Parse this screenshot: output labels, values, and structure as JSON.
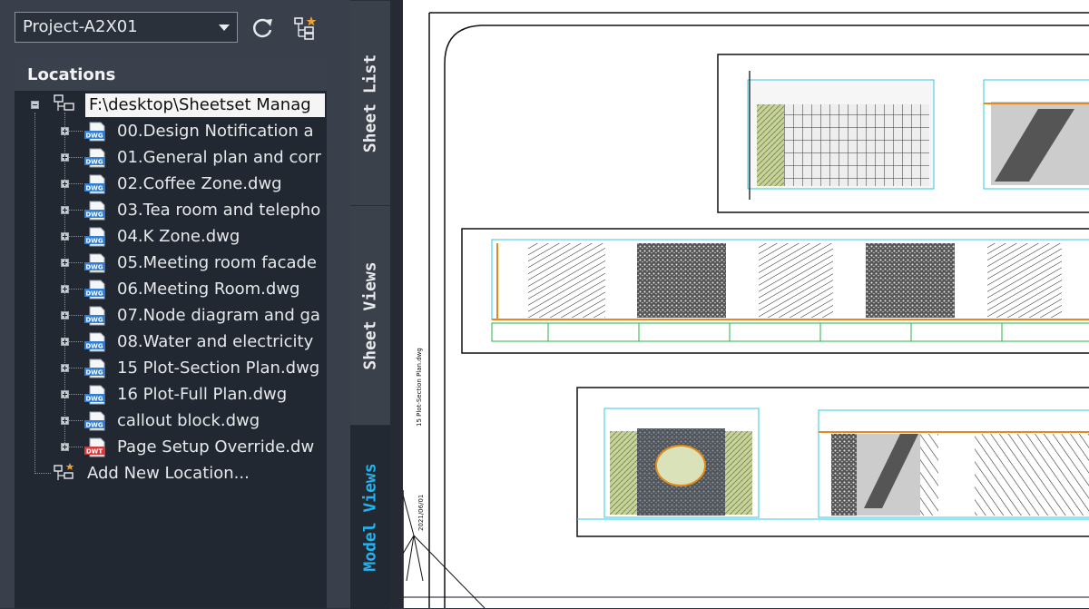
{
  "project_selector": {
    "value": "Project-A2X01"
  },
  "icons": {
    "refresh": "refresh-icon",
    "tree": "location-tree-icon"
  },
  "locations": {
    "header": "Locations",
    "root": {
      "label": "F:\\desktop\\Sheetset Manag"
    },
    "files": [
      {
        "label": "00.Design Notification a",
        "type": "DWG"
      },
      {
        "label": "01.General plan and corr",
        "type": "DWG"
      },
      {
        "label": "02.Coffee Zone.dwg",
        "type": "DWG"
      },
      {
        "label": "03.Tea room and telepho",
        "type": "DWG"
      },
      {
        "label": "04.K Zone.dwg",
        "type": "DWG"
      },
      {
        "label": "05.Meeting room facade",
        "type": "DWG"
      },
      {
        "label": "06.Meeting Room.dwg",
        "type": "DWG"
      },
      {
        "label": "07.Node diagram and ga",
        "type": "DWG"
      },
      {
        "label": "08.Water and electricity",
        "type": "DWG"
      },
      {
        "label": "15 Plot-Section Plan.dwg",
        "type": "DWG"
      },
      {
        "label": "16 Plot-Full Plan.dwg",
        "type": "DWG"
      },
      {
        "label": "callout block.dwg",
        "type": "DWG"
      },
      {
        "label": "Page Setup Override.dw",
        "type": "DWT"
      }
    ],
    "add_new": "Add New Location..."
  },
  "tabs": [
    {
      "label": "Sheet List",
      "active": false
    },
    {
      "label": "Sheet Views",
      "active": false
    },
    {
      "label": "Model Views",
      "active": true
    }
  ],
  "drawing": {
    "vertical_note_1": "15 Plot-Section Plan.dwg",
    "vertical_note_2": "2021/06/01"
  },
  "colors": {
    "accent": "#22b4f0",
    "panel": "#39404b",
    "tree_bg": "#222831",
    "dwg_icon": "#2f7fd8",
    "dwt_icon": "#d43a3a"
  }
}
